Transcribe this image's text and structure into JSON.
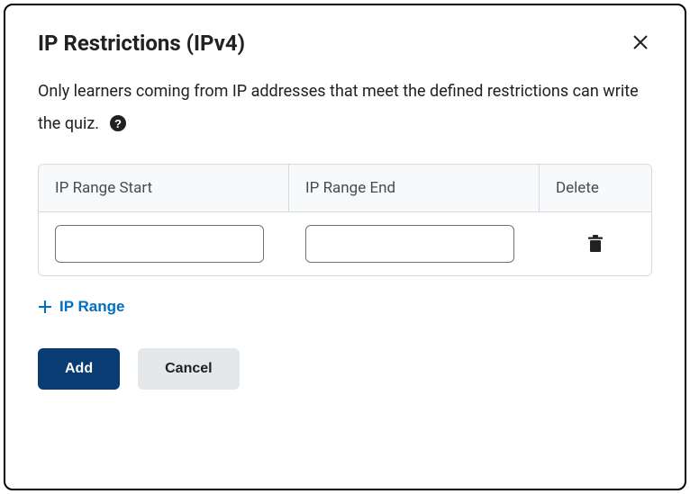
{
  "dialog": {
    "title": "IP Restrictions (IPv4)",
    "description": "Only learners coming from IP addresses that meet the defined restrictions can write the quiz."
  },
  "table": {
    "headers": {
      "start": "IP Range Start",
      "end": "IP Range End",
      "delete": "Delete"
    },
    "rows": [
      {
        "start": "",
        "end": ""
      }
    ]
  },
  "actions": {
    "addRange": "IP Range",
    "add": "Add",
    "cancel": "Cancel"
  }
}
